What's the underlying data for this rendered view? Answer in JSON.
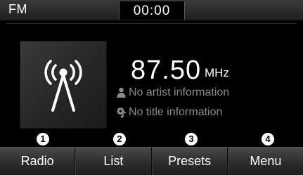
{
  "status_bar": {
    "band": "FM",
    "clock": "00:00"
  },
  "station": {
    "album_art_icon": "radio-signal-icon",
    "frequency": "87.50",
    "unit": "MHz",
    "artist": "No artist information",
    "artist_icon": "person-icon",
    "title": "No title information",
    "title_icon": "music-note-icon"
  },
  "callouts": [
    "1",
    "2",
    "3",
    "4"
  ],
  "softkeys": [
    {
      "label": "Radio"
    },
    {
      "label": "List"
    },
    {
      "label": "Presets"
    },
    {
      "label": "Menu"
    }
  ],
  "colors": {
    "background": "#000000",
    "text": "#ffffff",
    "secondary_text": "#8a8a8a"
  }
}
